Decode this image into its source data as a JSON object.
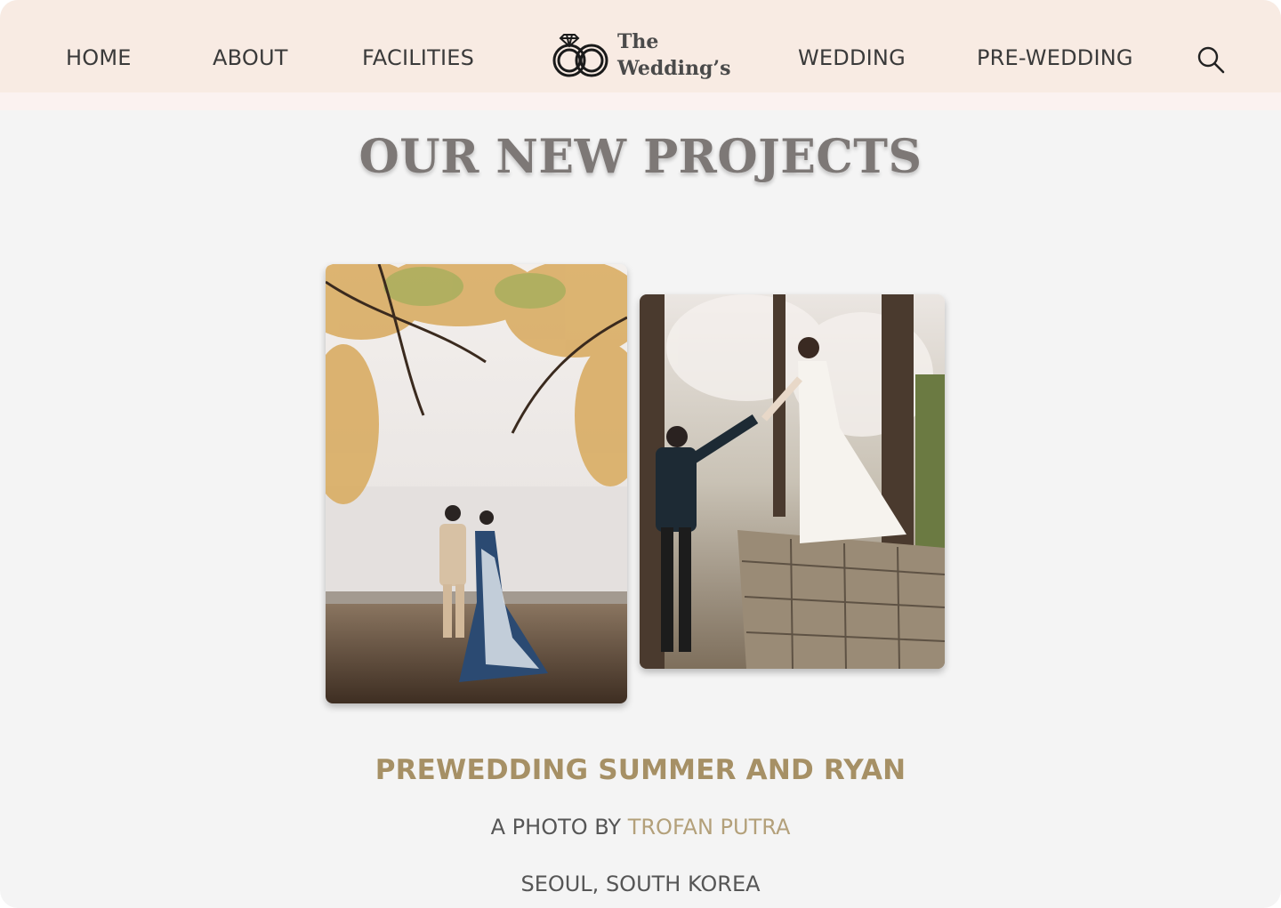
{
  "nav": {
    "items": [
      {
        "label": "HOME"
      },
      {
        "label": "ABOUT"
      },
      {
        "label": "FACILITIES"
      },
      {
        "label": "WEDDING"
      },
      {
        "label": "PRE-WEDDING"
      }
    ],
    "logo": {
      "line1": "The",
      "line2": "Wedding’s",
      "icon": "rings-icon"
    },
    "search_icon": "search-icon"
  },
  "main": {
    "title": "OUR NEW PROJECTS",
    "project": {
      "name": "PREWEDDING SUMMER AND RYAN",
      "credit_prefix": "A PHOTO BY",
      "photographer": "TROFAN PUTRA",
      "location": "SEOUL, SOUTH KOREA"
    }
  },
  "colors": {
    "header_bg": "#f8ebe3",
    "page_bg": "#f4f4f4",
    "accent_gold": "#a69065",
    "title_grey": "#7d7876"
  }
}
